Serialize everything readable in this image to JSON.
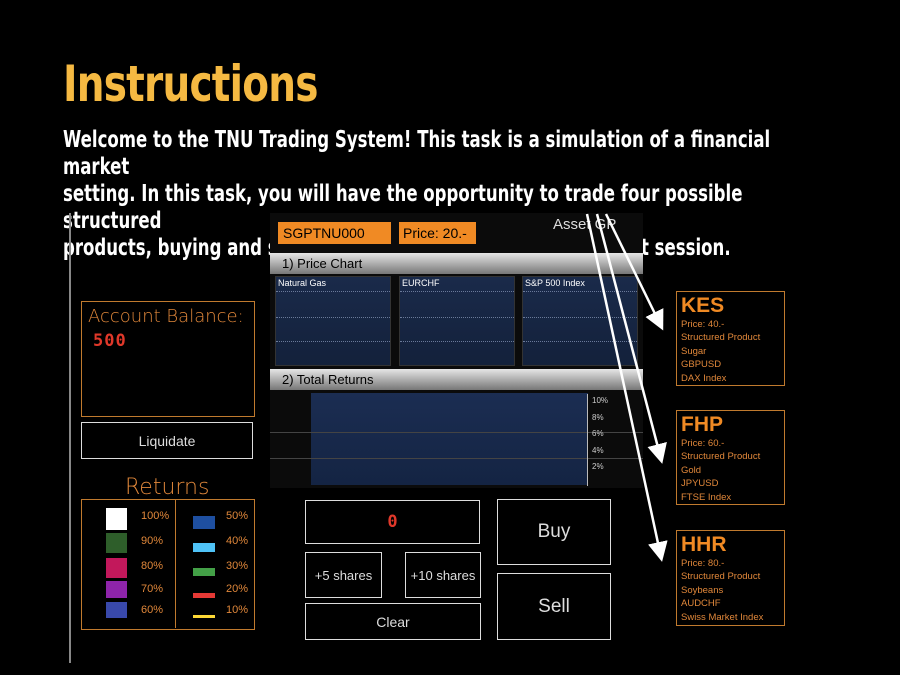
{
  "heading": "Instructions",
  "intro_line1": "Welcome to the TNU Trading System! This task is a simulation of a financial market",
  "intro_line2": "setting. In this task, you will have the opportunity to  trade four possible structured",
  "intro_line3": "products, buying and selling them over the course of a market session.",
  "account": {
    "label": "Account Balance:",
    "value": "500"
  },
  "liquidate_label": "Liquidate",
  "returns": {
    "title": "Returns",
    "legend": [
      {
        "label": "100%",
        "color": "#ffffff"
      },
      {
        "label": "90%",
        "color": "#2e5e2a"
      },
      {
        "label": "80%",
        "color": "#c2185b"
      },
      {
        "label": "70%",
        "color": "#8e24aa"
      },
      {
        "label": "60%",
        "color": "#3949ab"
      },
      {
        "label": "50%",
        "color": "#1e4fa0"
      },
      {
        "label": "40%",
        "color": "#4fc3f7"
      },
      {
        "label": "30%",
        "color": "#43a047"
      },
      {
        "label": "20%",
        "color": "#e53935"
      },
      {
        "label": "10%",
        "color": "#fdd835"
      }
    ]
  },
  "trading": {
    "ticker": "SGPTNU000",
    "price": "Price: 20.-",
    "asset": "Asset GP",
    "section1": "1) Price Chart",
    "section2": "2) Total Returns",
    "charts": [
      "Natural Gas",
      "EURCHF",
      "S&P 500 Index"
    ],
    "ticks": [
      "10%",
      "8%",
      "6%",
      "4%",
      "2%"
    ],
    "shares": "0",
    "plus5": "+5 shares",
    "plus10": "+10 shares",
    "clear": "Clear",
    "buy": "Buy",
    "sell": "Sell"
  },
  "products": [
    {
      "name": "KES",
      "price": "Price: 40.-",
      "type": "Structured Product",
      "u1": "Sugar",
      "u2": "GBPUSD",
      "u3": "DAX Index"
    },
    {
      "name": "FHP",
      "price": "Price: 60.-",
      "type": "Structured Product",
      "u1": "Gold",
      "u2": "JPYUSD",
      "u3": "FTSE Index"
    },
    {
      "name": "HHR",
      "price": "Price: 80.-",
      "type": "Structured Product",
      "u1": "Soybeans",
      "u2": "AUDCHF",
      "u3": "Swiss Market Index"
    }
  ]
}
